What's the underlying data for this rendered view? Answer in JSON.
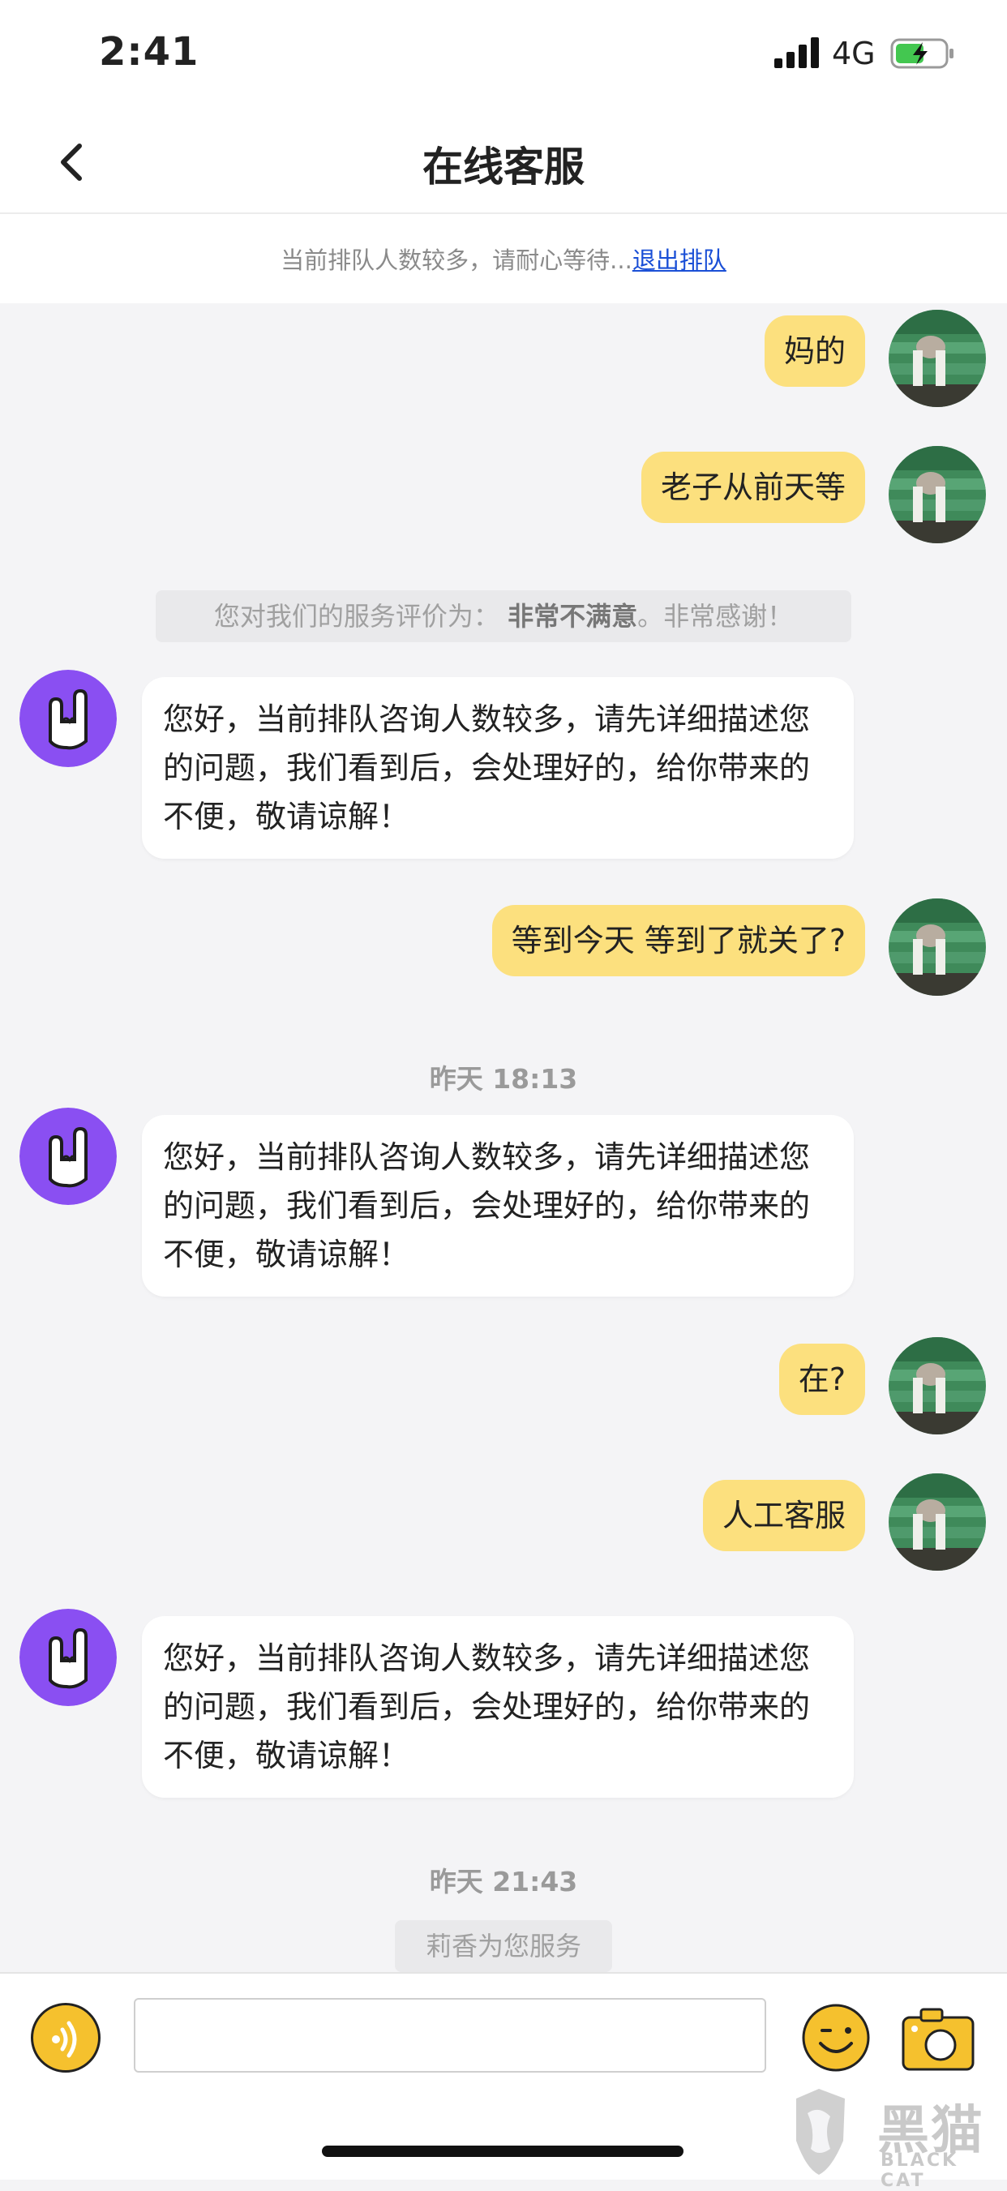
{
  "status_bar": {
    "time": "2:41",
    "network": "4G",
    "icons": [
      "signal-icon",
      "battery-charging-icon"
    ]
  },
  "nav": {
    "title": "在线客服",
    "back_icon": "chevron-left-icon"
  },
  "notice": {
    "text": "当前排队人数较多，请耐心等待...",
    "link": "退出排队"
  },
  "messages": [
    {
      "type": "user",
      "text": "妈的"
    },
    {
      "type": "user",
      "text": "老子从前天等"
    },
    {
      "type": "system",
      "prefix": "您对我们的服务评价为：",
      "rating": "非常不满意",
      "suffix": "。非常感谢！"
    },
    {
      "type": "bot",
      "text": "您好，当前排队咨询人数较多，请先详细描述您的问题，我们看到后，会处理好的，给你带来的不便，敬请谅解！"
    },
    {
      "type": "user",
      "text": "等到今天 等到了就关了?"
    },
    {
      "type": "time",
      "text": "昨天 18:13"
    },
    {
      "type": "bot",
      "text": "您好，当前排队咨询人数较多，请先详细描述您的问题，我们看到后，会处理好的，给你带来的不便，敬请谅解！"
    },
    {
      "type": "user",
      "text": "在?"
    },
    {
      "type": "user",
      "text": "人工客服"
    },
    {
      "type": "bot",
      "text": "您好，当前排队咨询人数较多，请先详细描述您的问题，我们看到后，会处理好的，给你带来的不便，敬请谅解！"
    },
    {
      "type": "time",
      "text": "昨天 21:43"
    },
    {
      "type": "system_simple",
      "text": "莉香为您服务"
    }
  ],
  "input_bar": {
    "placeholder": "",
    "voice_icon": "voice-icon",
    "emoji_icon": "emoji-icon",
    "camera_icon": "camera-icon"
  },
  "watermark": {
    "title": "黑猫",
    "subtitle": "BLACK CAT"
  },
  "colors": {
    "user_bubble": "#fce07e",
    "bot_avatar": "#8a4ff2",
    "accent_yellow": "#f5c12e",
    "link": "#1a4fd6"
  }
}
